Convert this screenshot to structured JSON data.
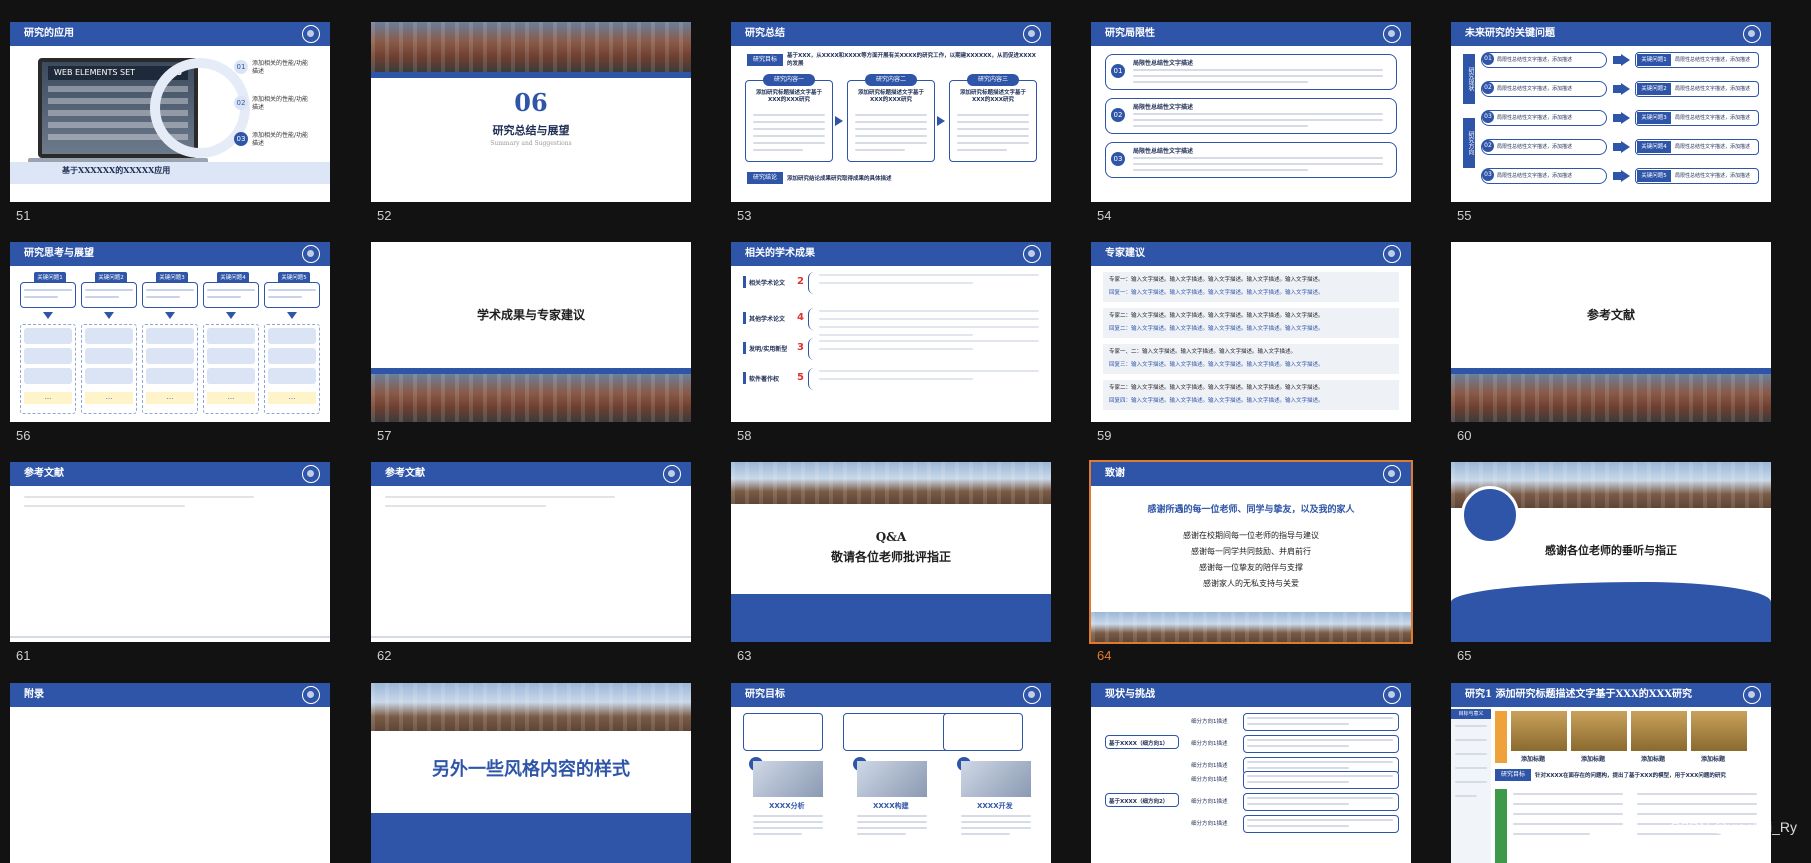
{
  "slides": [
    {
      "n": "51",
      "title": "研究的应用",
      "kind": "app",
      "badge": "WEB ELEMENTS SET",
      "badge_num": "16",
      "caption": "基于XXXXXX的XXXXX应用",
      "points": [
        {
          "no": "01",
          "text": "添加相关的性能/功能描述"
        },
        {
          "no": "02",
          "text": "添加相关的性能/功能描述"
        },
        {
          "no": "03",
          "text": "添加相关的性能/功能描述"
        }
      ]
    },
    {
      "n": "52",
      "title": "",
      "kind": "section",
      "big": "06",
      "sub": "研究总结与展望",
      "en": "Summary and Suggestions"
    },
    {
      "n": "53",
      "title": "研究总结",
      "kind": "summary",
      "row_a_label": "研究目标",
      "row_a_text": "基于XXX，从XXXX和XXXX等方面开展有关XXXX的研究工作，以期建XXXXXX，从而促进XXXX的发展",
      "cols": [
        "研究内容一",
        "研究内容二",
        "研究内容三"
      ],
      "col_head": "添加研究标题描述文字基于XXX的XXX研究",
      "row_b_label": "研究结论",
      "row_b_text": "添加研究结论成果研究取得成果的具体描述"
    },
    {
      "n": "54",
      "title": "研究局限性",
      "kind": "limits",
      "items": [
        {
          "no": "01",
          "head": "局限性总结性文字描述"
        },
        {
          "no": "02",
          "head": "局限性总结性文字描述"
        },
        {
          "no": "03",
          "head": "局限性总结性文字描述"
        }
      ]
    },
    {
      "n": "55",
      "title": "未来研究的关键问题",
      "kind": "future",
      "left_labels": [
        "研究现状",
        "研究方向"
      ],
      "rows": [
        {
          "no": "01",
          "text": "局限性总结性文字描述，添加描述",
          "key": "关键问题1"
        },
        {
          "no": "02",
          "text": "局限性总结性文字描述，添加描述",
          "key": "关键问题2"
        },
        {
          "no": "03",
          "text": "局限性总结性文字描述，添加描述",
          "key": "关键问题3"
        },
        {
          "no": "02",
          "text": "局限性总结性文字描述，添加描述",
          "key": "关键问题4"
        },
        {
          "no": "03",
          "text": "局限性总结性文字描述，添加描述",
          "key": "关键问题5"
        }
      ]
    },
    {
      "n": "56",
      "title": "研究思考与展望",
      "kind": "outlook",
      "heads": [
        "关键问题1",
        "关键问题2",
        "关键问题3",
        "关键问题4",
        "关键问题5"
      ],
      "more": "..."
    },
    {
      "n": "57",
      "title": "",
      "kind": "section2",
      "sub": "学术成果与专家建议"
    },
    {
      "n": "58",
      "title": "相关的学术成果",
      "kind": "achieve",
      "groups": [
        {
          "label": "相关学术论文",
          "count": "2"
        },
        {
          "label": "其他学术论文",
          "count": "4"
        },
        {
          "label": "发明/实用新型",
          "count": "3"
        },
        {
          "label": "软件著作权",
          "count": "5"
        }
      ]
    },
    {
      "n": "59",
      "title": "专家建议",
      "kind": "advice",
      "rows": [
        "专家一：输入文字描述。输入文字描述。输入文字描述。输入文字描述。输入文字描述。",
        "回复一：输入文字描述。输入文字描述。输入文字描述。输入文字描述。输入文字描述。",
        "专家二：输入文字描述。输入文字描述。输入文字描述。输入文字描述。输入文字描述。",
        "回复二：输入文字描述。输入文字描述。输入文字描述。输入文字描述。输入文字描述。",
        "专家一、二：输入文字描述。输入文字描述。输入文字描述。输入文字描述。",
        "回复三：输入文字描述。输入文字描述。输入文字描述。输入文字描述。输入文字描述。",
        "专家二：输入文字描述。输入文字描述。输入文字描述。输入文字描述。输入文字描述。",
        "回复四：输入文字描述。输入文字描述。输入文字描述。输入文字描述。输入文字描述。"
      ]
    },
    {
      "n": "60",
      "title": "",
      "kind": "section2",
      "sub": "参考文献"
    },
    {
      "n": "61",
      "title": "参考文献",
      "kind": "refs"
    },
    {
      "n": "62",
      "title": "参考文献",
      "kind": "refs"
    },
    {
      "n": "63",
      "title": "",
      "kind": "qa",
      "l1": "Q&A",
      "l2": "敬请各位老师批评指正"
    },
    {
      "n": "64",
      "title": "致谢",
      "kind": "thanks",
      "head": "感谢所遇的每一位老师、同学与挚友，以及我的家人",
      "lines": [
        "感谢在校期间每一位老师的指导与建议",
        "感谢每一同学共同鼓励、并肩前行",
        "感谢每一位挚友的陪伴与支撑",
        "感谢家人的无私支持与关爱"
      ]
    },
    {
      "n": "65",
      "title": "",
      "kind": "end",
      "text": "感谢各位老师的垂听与指正"
    },
    {
      "n": "",
      "title": "附录",
      "kind": "blank"
    },
    {
      "n": "",
      "title": "",
      "kind": "style",
      "text": "另外一些风格内容的样式"
    },
    {
      "n": "",
      "title": "研究目标",
      "kind": "goal",
      "cards": [
        {
          "no": "1",
          "name": "XXXX分析"
        },
        {
          "no": "2",
          "name": "XXXX构建"
        },
        {
          "no": "3",
          "name": "XXXX开发"
        }
      ]
    },
    {
      "n": "",
      "title": "现状与挑战",
      "kind": "status",
      "branches": [
        "基于XXXX（细方向1）",
        "基于XXXX（细方向2）"
      ],
      "leaf": "细分方向1描述"
    },
    {
      "n": "",
      "title": "研究1 添加研究标题描述文字基于XXX的XXX研究",
      "kind": "research1",
      "side": [
        "目标与意义"
      ],
      "pics": [
        "添加标题",
        "添加标题",
        "添加标题",
        "添加标题"
      ],
      "goal_label": "研究目标",
      "goal_text": "针对XXXX在面存在的问题构，提出了基于XXX的模型，用于XXX问题的研究"
    }
  ],
  "watermark": "CSDN @xiaobai_Ry",
  "selected_slide": "64",
  "colors": {
    "accent": "#2f55a8",
    "selected": "#e07a2e",
    "bg": "#121212"
  }
}
